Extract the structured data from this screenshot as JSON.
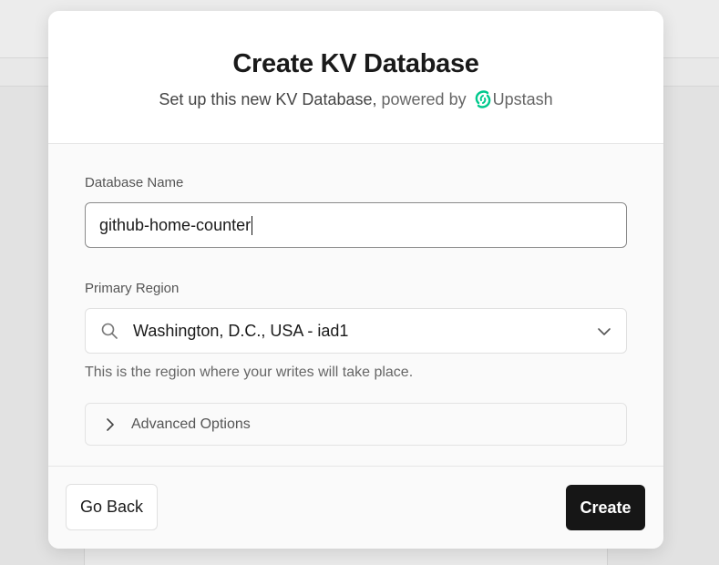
{
  "modal": {
    "title": "Create KV Database",
    "subtitle_main": "Set up this new KV Database,",
    "subtitle_powered": "powered by",
    "provider_name": "Upstash",
    "provider_color": "#00c98d"
  },
  "form": {
    "name_label": "Database Name",
    "name_value": "github-home-counter",
    "region_label": "Primary Region",
    "region_value": "Washington, D.C., USA - iad1",
    "region_helper": "This is the region where your writes will take place.",
    "advanced_label": "Advanced Options"
  },
  "footer": {
    "back_label": "Go Back",
    "create_label": "Create"
  },
  "icons": {
    "logo": "upstash-logo-icon",
    "search": "search-icon",
    "dropdown": "chevron-down-icon",
    "expand": "chevron-right-icon"
  }
}
